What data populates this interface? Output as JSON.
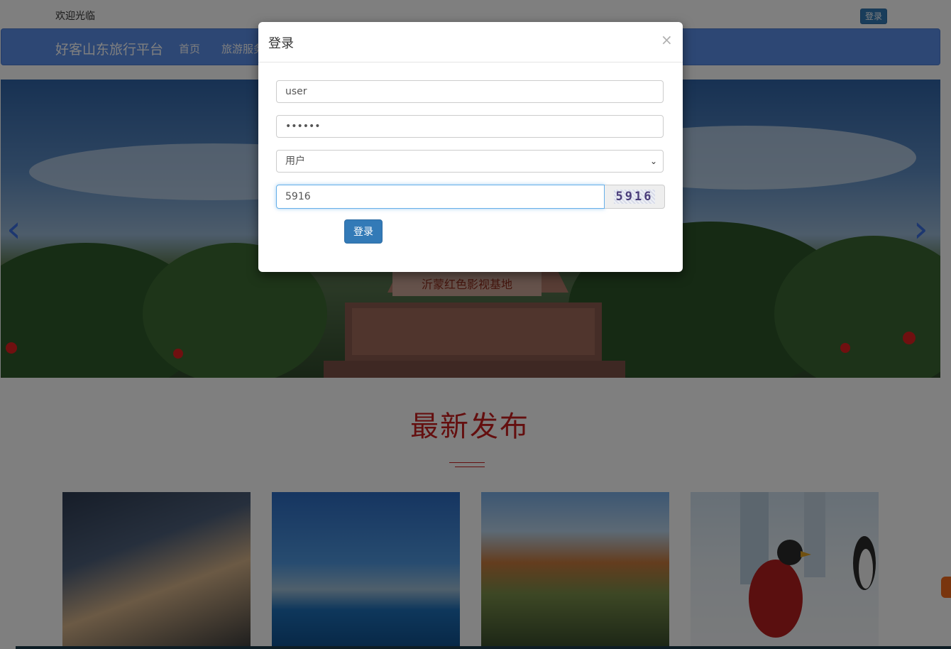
{
  "header": {
    "welcome": "欢迎光临",
    "login_button": "登录"
  },
  "navbar": {
    "brand": "好客山东旅行平台",
    "items": [
      "首页",
      "旅游服务"
    ]
  },
  "carousel": {
    "prev_arrow": "‹",
    "next_arrow": "›",
    "slide_count": 3,
    "active_slide": 1,
    "monument_text": "沂蒙红色影视基地"
  },
  "section": {
    "title": "最新发布"
  },
  "modal": {
    "title": "登录",
    "close": "×",
    "username_value": "user",
    "password_value": "123456",
    "role_selected": "用户",
    "role_options": [
      "用户"
    ],
    "captcha_value": "5916",
    "captcha_image_text": "5916",
    "submit_label": "登录"
  },
  "colors": {
    "primary": "#337ab7",
    "navbar": "#5b8ee8",
    "section_title": "#c81e1e"
  }
}
